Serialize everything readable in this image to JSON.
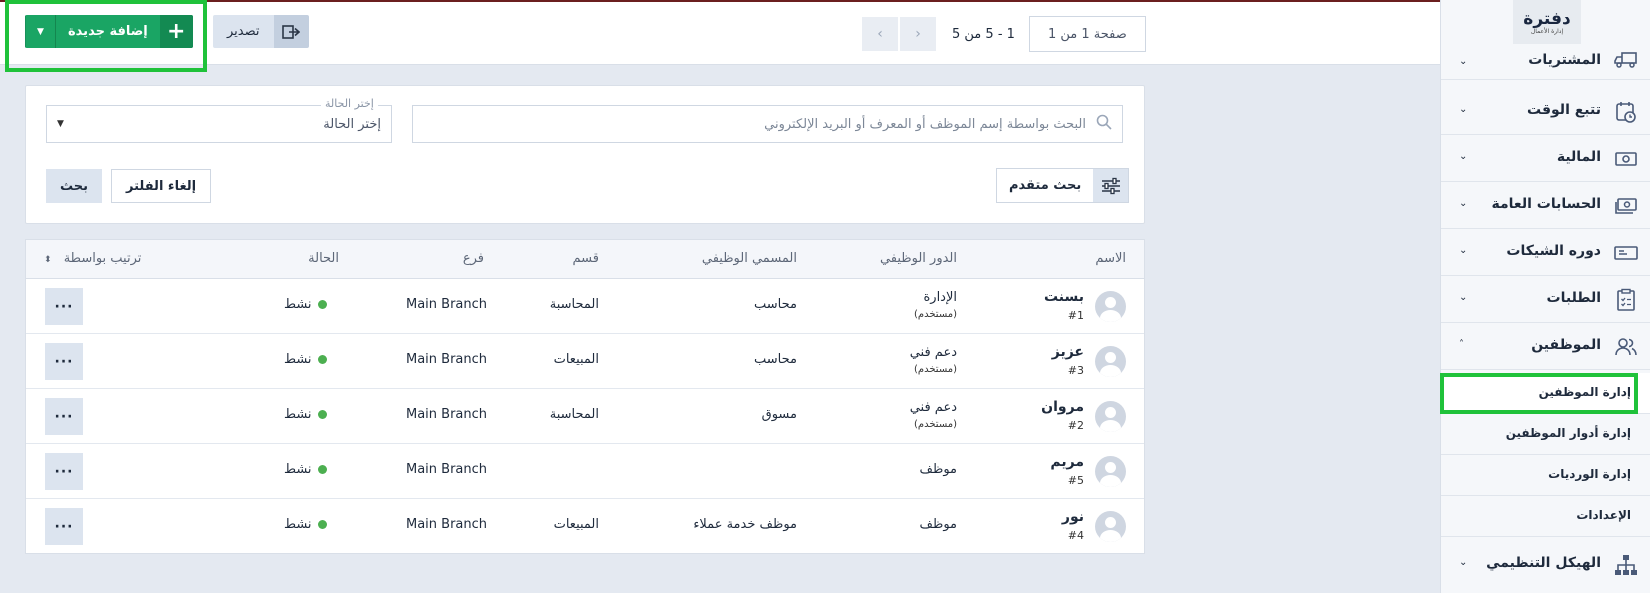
{
  "toolbar": {
    "add_label": "إضافة جديدة",
    "add_icon": "plus-icon",
    "add_caret_icon": "caret-down-icon",
    "export_label": "تصدير",
    "export_icon": "export-icon",
    "pager_prev_icon": "chevron-left-icon",
    "pager_next_icon": "chevron-right-icon",
    "pager_range": "1 - 5 من 5",
    "pager_page": "صفحة 1 من 1"
  },
  "filters": {
    "search_placeholder": "البحث بواسطة إسم الموظف أو المعرف أو البريد الإلكتروني",
    "status_floating_label": "إختر الحالة",
    "status_value": "إختر الحالة",
    "advanced_search_label": "بحث متقدم",
    "cancel_filter_label": "إلغاء الفلتر",
    "search_button_label": "بحث"
  },
  "table": {
    "headers": {
      "name": "الاسم",
      "role": "الدور الوظيفي",
      "job_title": "المسمي الوظيفي",
      "department": "قسم",
      "branch": "فرع",
      "status": "الحالة",
      "sort_by": "ترتيب بواسطة"
    },
    "rows": [
      {
        "name": "بسنت",
        "id": "#1",
        "role": "الإدارة",
        "role_sub": "(مستخدم)",
        "job_title": "محاسب",
        "department": "المحاسبة",
        "branch": "Main Branch",
        "status": "نشط",
        "more": "···"
      },
      {
        "name": "عزيز",
        "id": "#3",
        "role": "دعم فني",
        "role_sub": "(مستخدم)",
        "job_title": "محاسب",
        "department": "المبيعات",
        "branch": "Main Branch",
        "status": "نشط",
        "more": "···"
      },
      {
        "name": "مروان",
        "id": "#2",
        "role": "دعم فني",
        "role_sub": "(مستخدم)",
        "job_title": "مسوق",
        "department": "المحاسبة",
        "branch": "Main Branch",
        "status": "نشط",
        "more": "···"
      },
      {
        "name": "مريم",
        "id": "#5",
        "role": "موظف",
        "role_sub": "",
        "job_title": "",
        "department": "",
        "branch": "Main Branch",
        "status": "نشط",
        "more": "···"
      },
      {
        "name": "نور",
        "id": "#4",
        "role": "موظف",
        "role_sub": "",
        "job_title": "موظف خدمة عملاء",
        "department": "المبيعات",
        "branch": "Main Branch",
        "status": "نشط",
        "more": "···"
      }
    ]
  },
  "sidebar": {
    "logo": "دفترة",
    "logo_sub": "إدارة الأعمال",
    "items": [
      {
        "label": "المشتريات",
        "icon": "truck-icon"
      },
      {
        "label": "تتبع الوقت",
        "icon": "clock-icon"
      },
      {
        "label": "المالية",
        "icon": "money-icon"
      },
      {
        "label": "الحسابات العامة",
        "icon": "cash-icon"
      },
      {
        "label": "دوره الشيكات",
        "icon": "cheque-icon"
      },
      {
        "label": "الطلبات",
        "icon": "clipboard-icon"
      },
      {
        "label": "الموظفين",
        "icon": "users-icon"
      }
    ],
    "sub_items": [
      {
        "label": "إدارة الموظفين"
      },
      {
        "label": "إدارة أدوار الموظفين"
      },
      {
        "label": "إدارة الورديات"
      },
      {
        "label": "الإعدادات"
      }
    ],
    "bottom_item": {
      "label": "الهيكل التنظيمي",
      "icon": "org-chart-icon"
    }
  },
  "colors": {
    "accent_green": "#1aa564",
    "highlight_green": "#1fc23a",
    "status_active": "#4caf50"
  }
}
